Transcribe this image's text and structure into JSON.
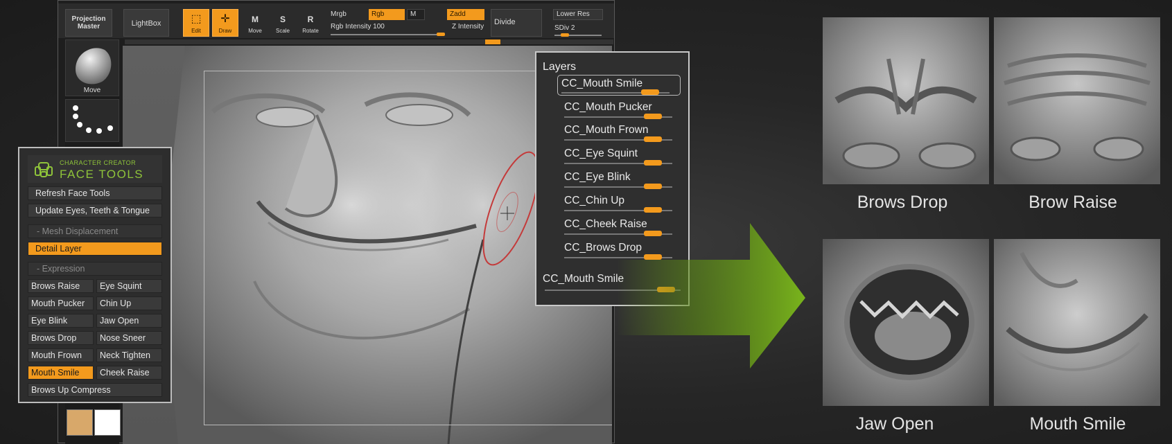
{
  "toolbar": {
    "projection_master": "Projection Master",
    "lightbox": "LightBox",
    "edit": "Edit",
    "draw": "Draw",
    "move": "Move",
    "scale": "Scale",
    "rotate": "Rotate",
    "mrgb": "Mrgb",
    "rgb": "Rgb",
    "m": "M",
    "zadd": "Zadd",
    "rgb_intensity": "Rgb Intensity 100",
    "z_intensity": "Z Intensity",
    "divide": "Divide",
    "lower_res": "Lower Res",
    "sdiv": "SDiv 2"
  },
  "left_dock": {
    "brush_label": "Move",
    "swatch_colors": [
      "#d8a86a",
      "#ffffff"
    ]
  },
  "face_tools": {
    "logo_line1": "CHARACTER CREATOR",
    "logo_line2": "FACE TOOLS",
    "refresh": "Refresh Face Tools",
    "update": "Update Eyes, Teeth & Tongue",
    "mesh_displacement": "- Mesh Displacement",
    "detail_layer": "Detail Layer",
    "expression": "- Expression",
    "buttons": [
      [
        "Brows Raise",
        "Eye Squint"
      ],
      [
        "Mouth Pucker",
        "Chin Up"
      ],
      [
        "Eye Blink",
        "Jaw Open"
      ],
      [
        "Brows Drop",
        "Nose Sneer"
      ],
      [
        "Mouth Frown",
        "Neck Tighten"
      ],
      [
        "Mouth Smile",
        "Cheek Raise"
      ]
    ],
    "brows_up_compress": "Brows Up Compress",
    "active_expression": "Mouth Smile"
  },
  "layers": {
    "title": "Layers",
    "items": [
      {
        "name": "CC_Mouth Smile",
        "level": 0.82
      },
      {
        "name": "CC_Mouth Pucker",
        "level": 0.82
      },
      {
        "name": "CC_Mouth Frown",
        "level": 0.82
      },
      {
        "name": "CC_Eye Squint",
        "level": 0.82
      },
      {
        "name": "CC_Eye Blink",
        "level": 0.82
      },
      {
        "name": "CC_Chin Up",
        "level": 0.82
      },
      {
        "name": "CC_Cheek Raise",
        "level": 0.82
      },
      {
        "name": "CC_Brows Drop",
        "level": 0.82
      }
    ],
    "selected": "CC_Mouth Smile",
    "footer_label": "CC_Mouth Smile",
    "footer_level": 0.9
  },
  "results": [
    {
      "caption": "Brows Drop"
    },
    {
      "caption": "Brow Raise"
    },
    {
      "caption": "Jaw Open"
    },
    {
      "caption": "Mouth Smile"
    }
  ],
  "colors": {
    "accent": "#f39a1d",
    "logo_green": "#8fc43a",
    "arrow_green": "#6fa21a"
  }
}
